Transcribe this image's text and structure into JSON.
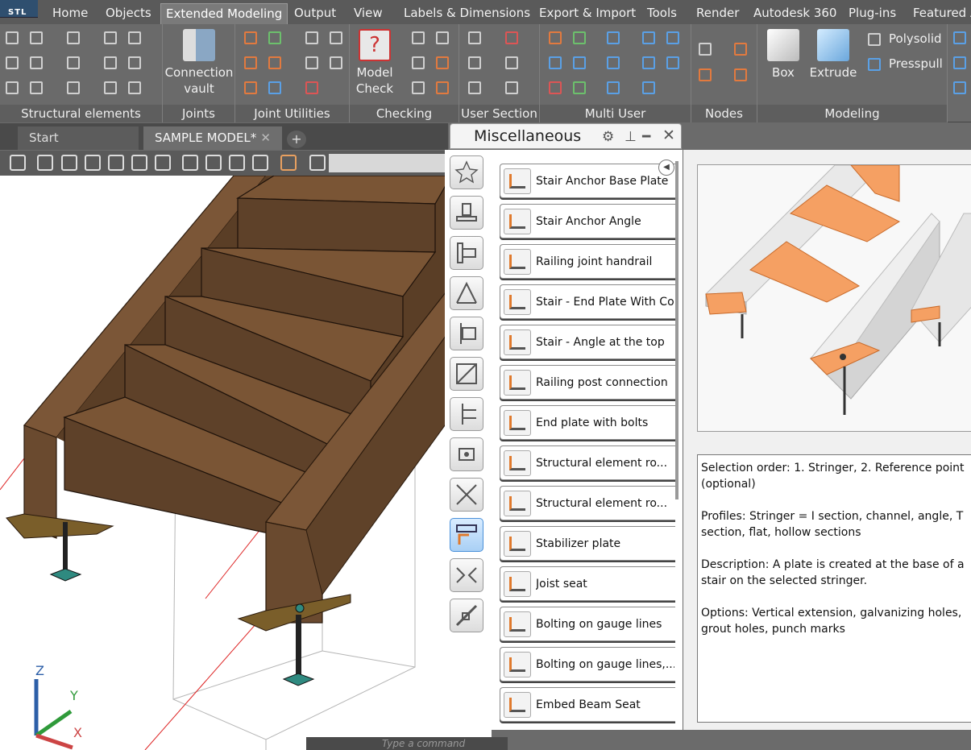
{
  "ribbon": {
    "app_label": "STL",
    "tabs": [
      "Home",
      "Objects",
      "Extended Modeling",
      "Output",
      "View",
      "Labels & Dimensions",
      "Export & Import",
      "Tools",
      "Render",
      "Autodesk 360",
      "Plug-ins",
      "Featured A"
    ],
    "active_tab": "Extended Modeling",
    "groups": {
      "structural": "Structural elements",
      "joints": "Joints",
      "joint_utilities": "Joint Utilities",
      "checking": "Checking",
      "user_section": "User Section",
      "multi_user": "Multi User",
      "nodes": "Nodes",
      "modeling": "Modeling"
    },
    "buttons": {
      "connection_vault": "Connection vault",
      "model_check": "Model Check",
      "box": "Box",
      "extrude": "Extrude",
      "polysolid": "Polysolid",
      "presspull": "Presspull"
    }
  },
  "documents": {
    "start": "Start",
    "active": "SAMPLE MODEL*",
    "close_glyph": "✕",
    "add_glyph": "+"
  },
  "command_line": {
    "placeholder": "Type a command"
  },
  "palette": {
    "title": "Miscellaneous",
    "items": [
      "Stair Anchor Base Plate",
      "Stair Anchor Angle",
      "Railing joint handrail",
      "Stair - End Plate With Cope",
      "Stair - Angle at the top",
      "Railing post connection",
      "End plate with bolts",
      "Structural element ro...",
      "Structural element ro...",
      "Stabilizer plate",
      "Joist seat",
      "Bolting on gauge lines",
      "Bolting on gauge lines,...",
      "Embed Beam Seat"
    ]
  },
  "description": {
    "selection": "Selection order: 1. Stringer, 2. Reference point (optional)",
    "profiles": "Profiles: Stringer = I section, channel, angle, T section, flat, hollow sections",
    "text": "Description: A plate is created at the base of a stair on the selected stringer.",
    "options": "Options: Vertical extension, galvanizing holes, grout holes, punch marks"
  },
  "axes": {
    "z": "Z",
    "y": "Y",
    "x": "X"
  },
  "colors": {
    "stair_wood": "#6b4a2e",
    "stair_dark": "#4f3520",
    "plate_gold": "#7a5e2a",
    "anchor_teal": "#2f8a80",
    "preview_orange": "#f5a063"
  }
}
